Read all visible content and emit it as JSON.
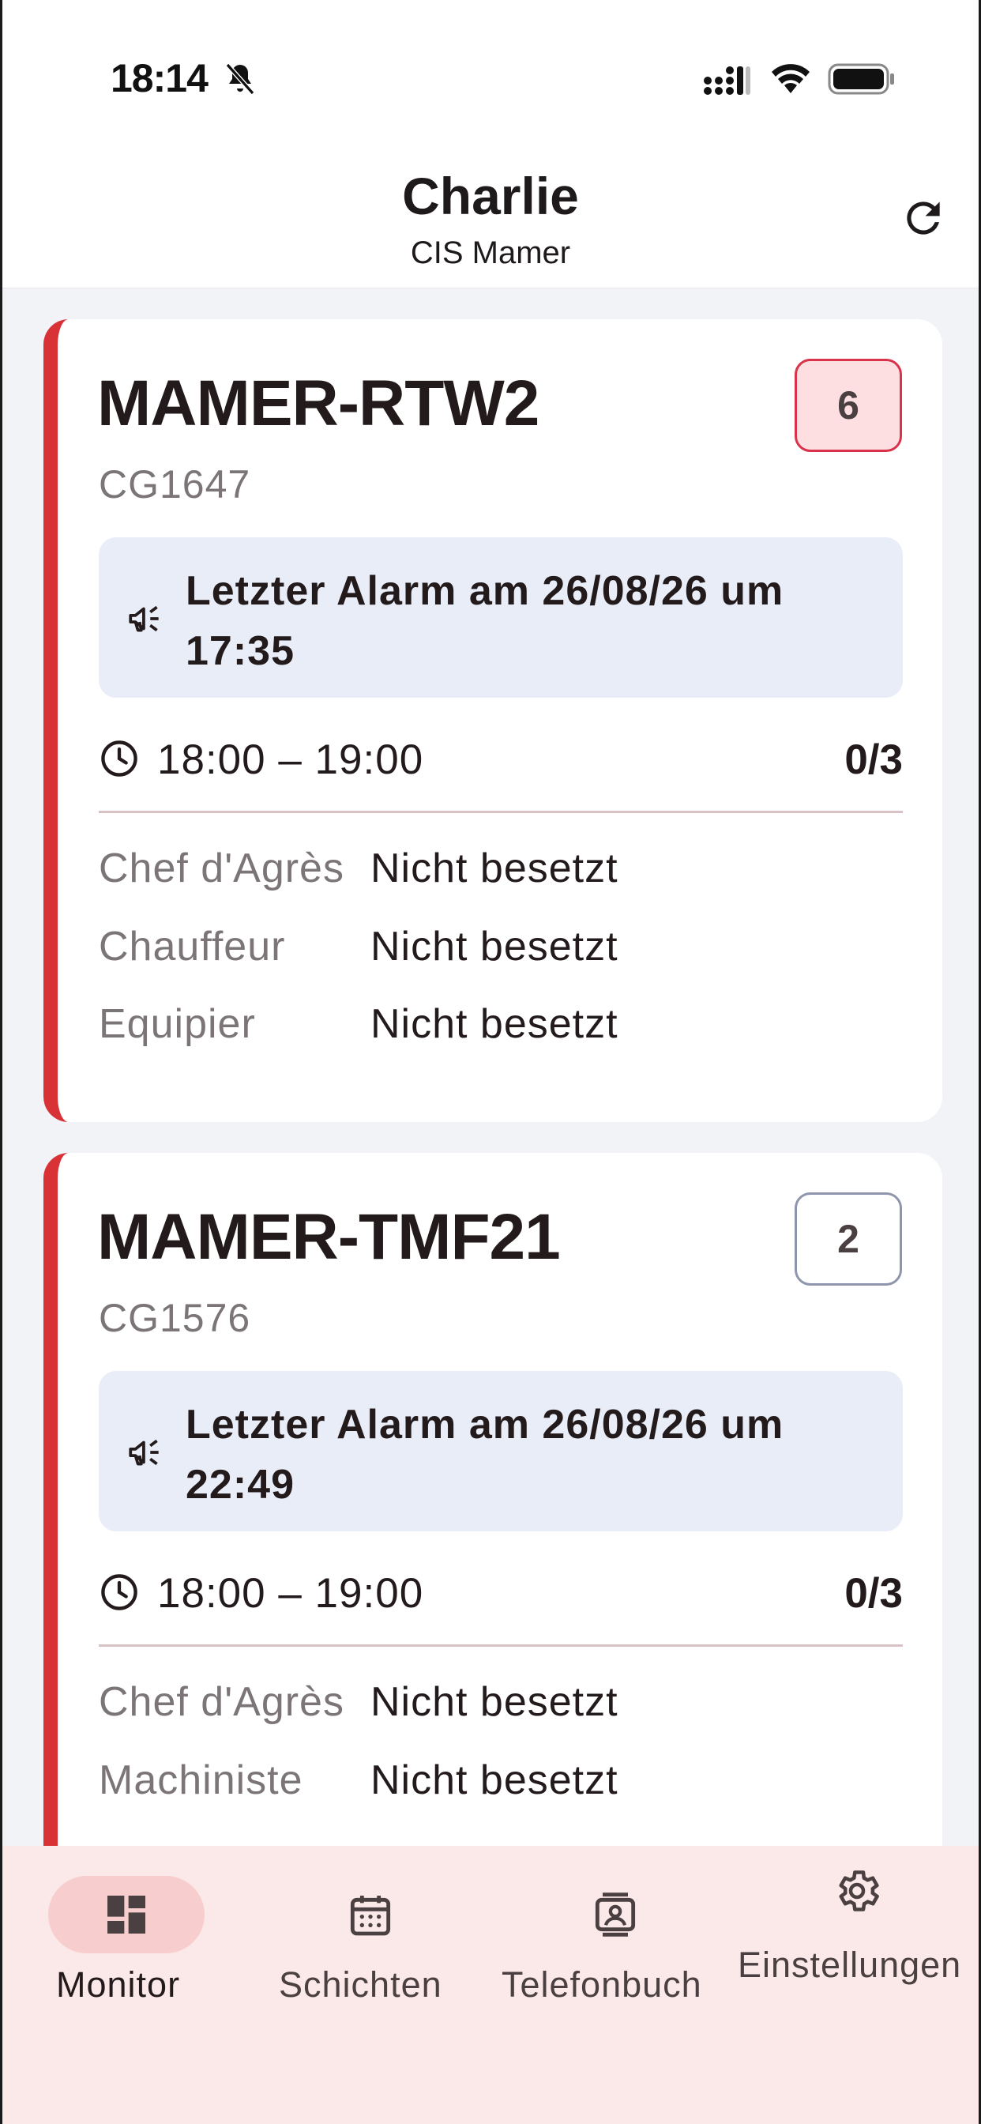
{
  "status_bar": {
    "time": "18:14",
    "icons": [
      "bell-slash-icon",
      "signal-icon",
      "wifi-icon",
      "battery-icon"
    ]
  },
  "header": {
    "title": "Charlie",
    "subtitle": "CIS Mamer",
    "refresh_icon": "refresh-icon"
  },
  "units": [
    {
      "name": "MAMER-RTW2",
      "code": "CG1647",
      "badge": "6",
      "badge_style": "alert",
      "alarm_text": "Letzter Alarm am 26/08/26 um 17:35",
      "time_range": "18:00 – 19:00",
      "count": "0/3",
      "roles": [
        {
          "label": "Chef d'Agrès",
          "value": "Nicht besetzt"
        },
        {
          "label": "Chauffeur",
          "value": "Nicht besetzt"
        },
        {
          "label": "Equipier",
          "value": "Nicht besetzt"
        }
      ]
    },
    {
      "name": "MAMER-TMF21",
      "code": "CG1576",
      "badge": "2",
      "badge_style": "plain",
      "alarm_text": "Letzter Alarm am 26/08/26 um 22:49",
      "time_range": "18:00 – 19:00",
      "count": "0/3",
      "roles": [
        {
          "label": "Chef d'Agrès",
          "value": "Nicht besetzt"
        },
        {
          "label": "Machiniste",
          "value": "Nicht besetzt"
        }
      ]
    }
  ],
  "nav": {
    "items": [
      {
        "label": "Monitor",
        "icon": "dashboard-icon",
        "active": true
      },
      {
        "label": "Schichten",
        "icon": "calendar-icon",
        "active": false
      },
      {
        "label": "Telefonbuch",
        "icon": "contacts-icon",
        "active": false
      },
      {
        "label": "Einstellungen",
        "icon": "gear-icon",
        "active": false
      }
    ]
  },
  "colors": {
    "accent_red": "#d93236",
    "alarm_bg": "#e8edf8",
    "nav_bg": "#fbe8e8",
    "nav_active_pill": "#f7cdcd"
  }
}
